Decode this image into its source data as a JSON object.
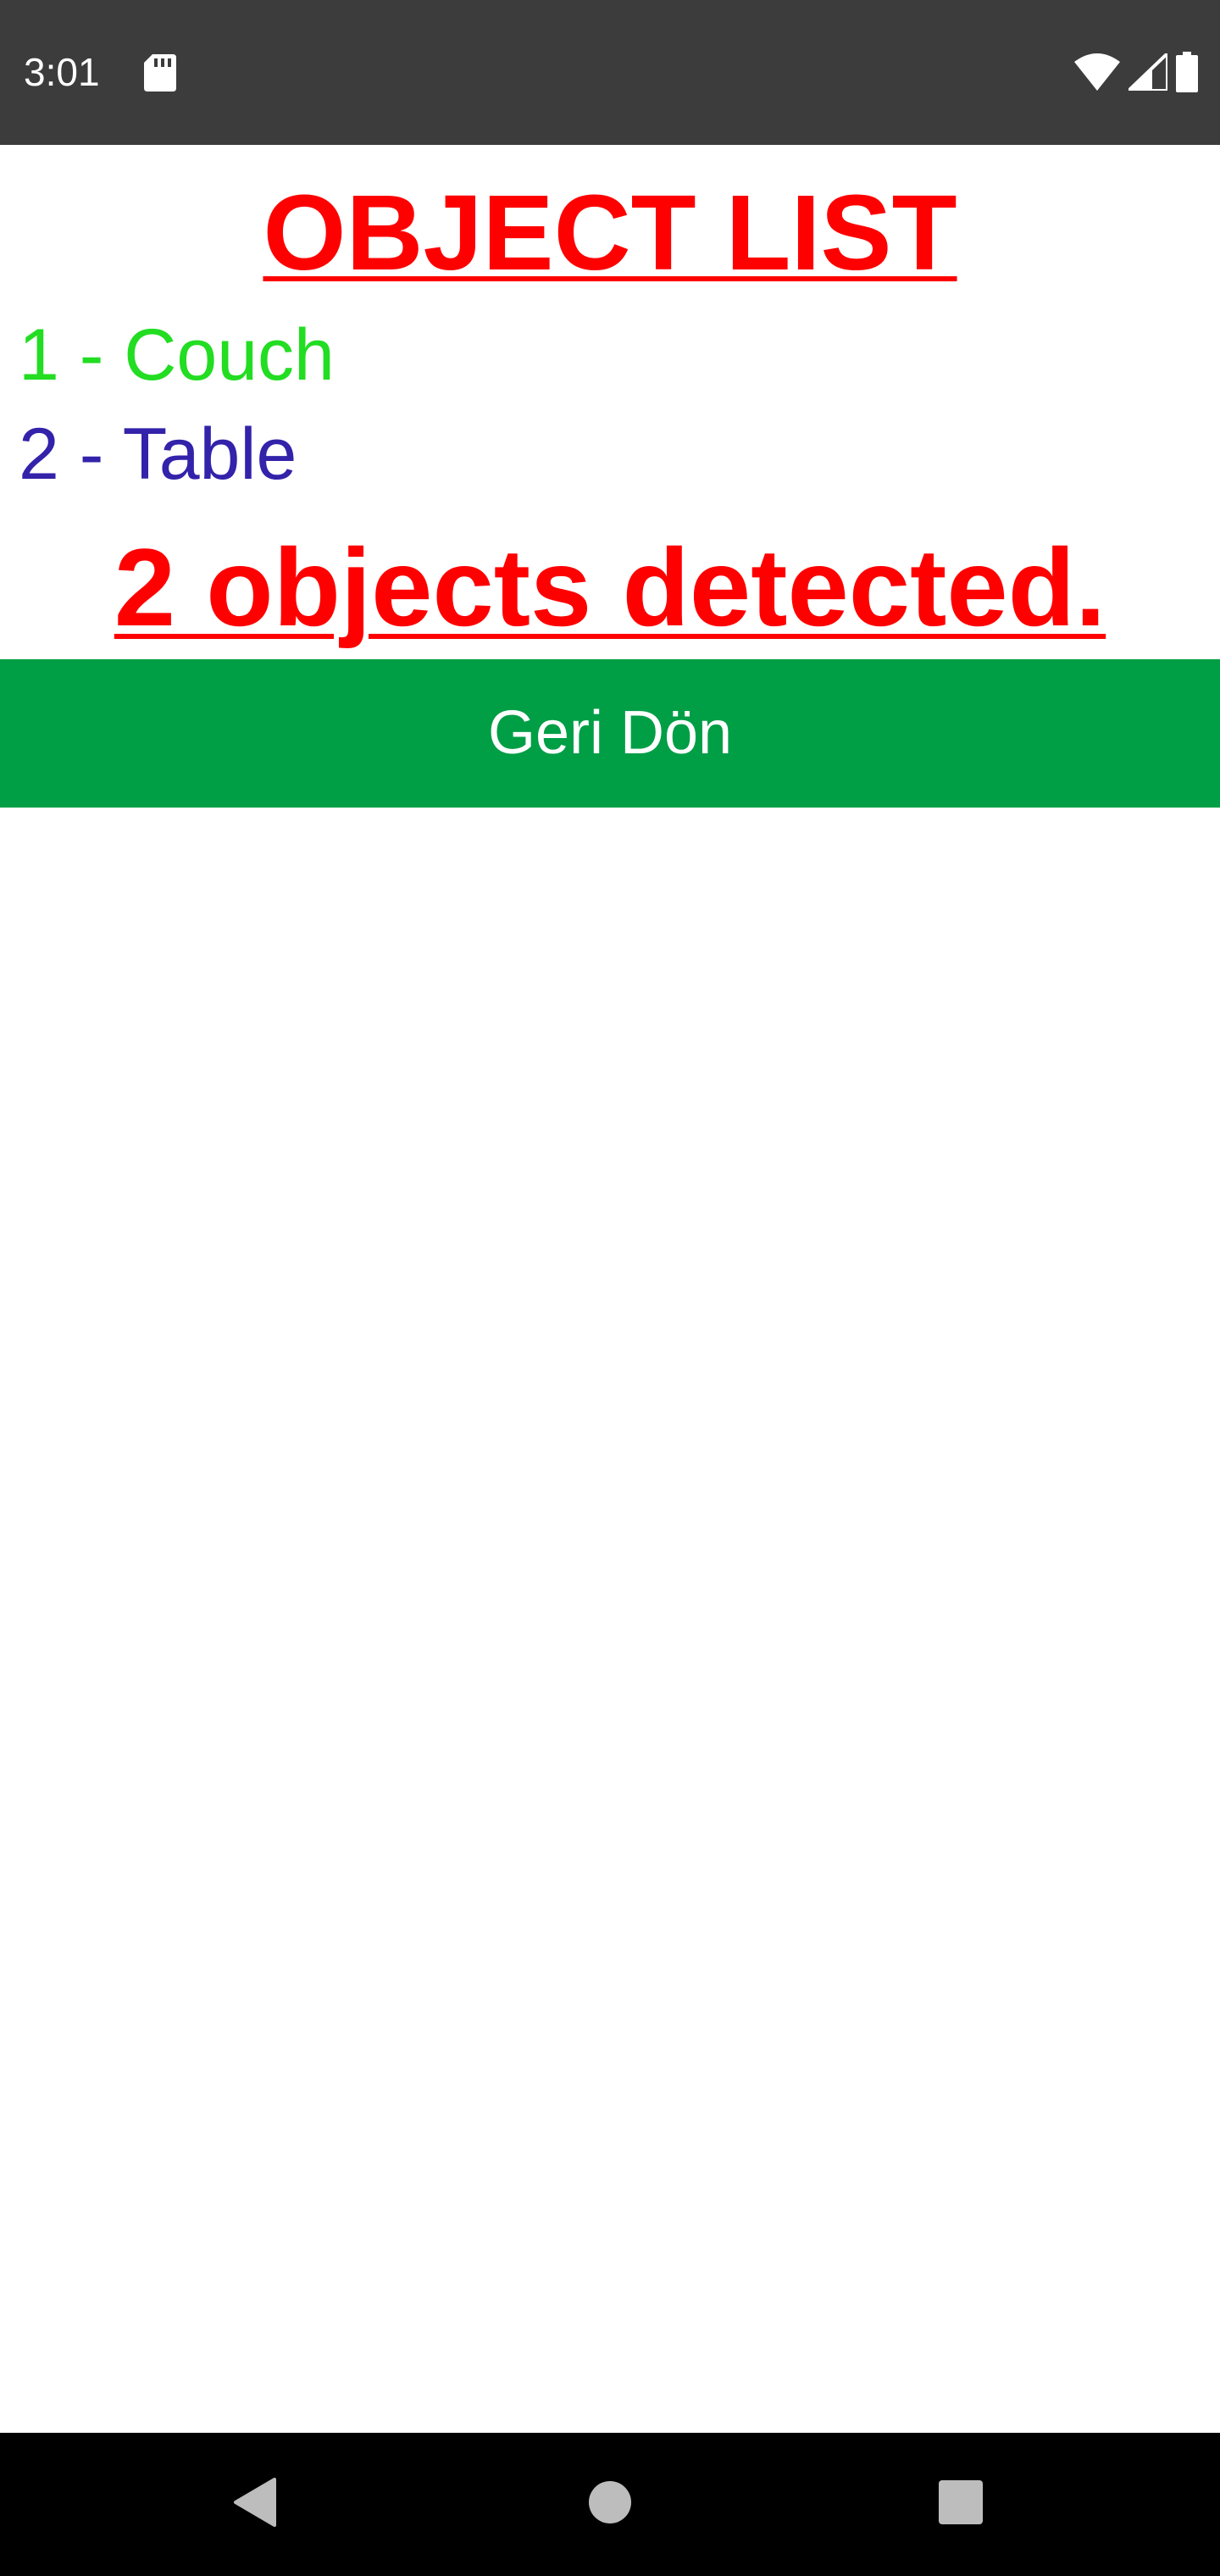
{
  "status_bar": {
    "time": "3:01",
    "icons": [
      "sd-card-icon",
      "wifi-icon",
      "cell-signal-icon",
      "battery-icon"
    ]
  },
  "main": {
    "title": "OBJECT LIST",
    "objects": [
      {
        "label": "1 - Couch",
        "color": "#22dd22"
      },
      {
        "label": "2 - Table",
        "color": "#3322aa"
      }
    ],
    "summary": "2 objects detected.",
    "back_button_label": "Geri Dön"
  },
  "colors": {
    "title": "#ff0000",
    "button_bg": "#009e45",
    "status_bar_bg": "#3c3c3c",
    "nav_bar_bg": "#000000"
  },
  "nav_bar": {
    "buttons": [
      "back-icon",
      "home-icon",
      "recents-icon"
    ]
  }
}
